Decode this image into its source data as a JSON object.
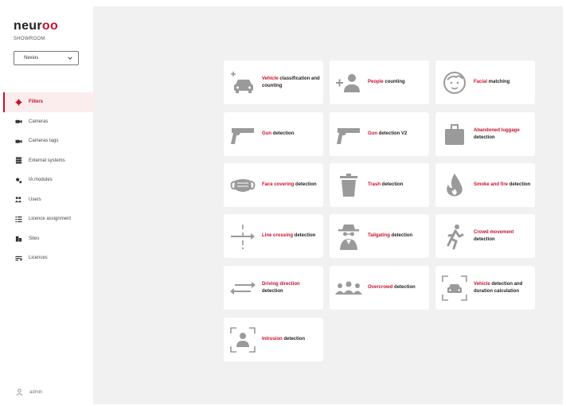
{
  "app": {
    "logo_text": "neur",
    "logo_oo": "oo",
    "subtitle": "SHOWROOM"
  },
  "site_select": {
    "value": "Nexios"
  },
  "nav": [
    {
      "label": "Filters",
      "icon": "filter-icon",
      "active": true
    },
    {
      "label": "Cameras",
      "icon": "camera-icon"
    },
    {
      "label": "Cameras tags",
      "icon": "camera-tag-icon"
    },
    {
      "label": "External systems",
      "icon": "server-icon"
    },
    {
      "label": "IA modules",
      "icon": "cogs-icon"
    },
    {
      "label": "Users",
      "icon": "users-icon"
    },
    {
      "label": "Licence assignment",
      "icon": "list-check-icon"
    },
    {
      "label": "Sites",
      "icon": "building-icon"
    },
    {
      "label": "Licences",
      "icon": "licence-icon"
    }
  ],
  "user": {
    "label": "admin",
    "icon": "user-icon"
  },
  "colors": {
    "accent": "#c8102e",
    "content_bg": "#f1f1f2",
    "icon_grey": "#9a9a9a"
  },
  "cards": [
    {
      "hl": "Vehicle",
      "rest": " classification and counting",
      "icon": "vehicle-classification-icon"
    },
    {
      "hl": "People",
      "rest": " counting",
      "icon": "people-counting-icon"
    },
    {
      "hl": "Facial",
      "rest": " matching",
      "icon": "facial-matching-icon"
    },
    {
      "hl": "Gun",
      "rest": " detection",
      "icon": "gun-icon"
    },
    {
      "hl": "Gun",
      "rest": " detection V2",
      "icon": "gun-v2-icon"
    },
    {
      "hl": "Abandoned luggage",
      "rest": " detection",
      "icon": "luggage-icon"
    },
    {
      "hl": "Face covering",
      "rest": " detection",
      "icon": "face-mask-icon"
    },
    {
      "hl": "Trash",
      "rest": " detection",
      "icon": "trash-icon"
    },
    {
      "hl": "Smoke and fire",
      "rest": " detection",
      "icon": "fire-icon"
    },
    {
      "hl": "Line crossing",
      "rest": " detection",
      "icon": "line-crossing-icon"
    },
    {
      "hl": "Tailgating",
      "rest": " detection",
      "icon": "tailgating-icon"
    },
    {
      "hl": "Crowd movement",
      "rest": " detection",
      "icon": "crowd-movement-icon"
    },
    {
      "hl": "Driving direction",
      "rest": " detection",
      "icon": "driving-direction-icon"
    },
    {
      "hl": "Overcrowd",
      "rest": " detection",
      "icon": "overcrowd-icon"
    },
    {
      "hl": "Vehicle",
      "rest": " detection and duration calculation",
      "icon": "vehicle-duration-icon"
    },
    {
      "hl": "Intrusion",
      "rest": " detection",
      "icon": "intrusion-icon"
    }
  ]
}
